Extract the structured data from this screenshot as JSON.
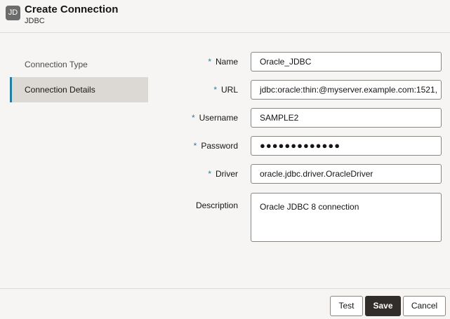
{
  "header": {
    "badge": "JD",
    "title": "Create Connection",
    "subtitle": "JDBC"
  },
  "nav": {
    "items": [
      {
        "label": "Connection Type",
        "active": false
      },
      {
        "label": "Connection Details",
        "active": true
      }
    ]
  },
  "form": {
    "required_marker": "*",
    "name": {
      "label": "Name",
      "value": "Oracle_JDBC"
    },
    "url": {
      "label": "URL",
      "value": "jdbc:oracle:thin:@myserver.example.com:1521,"
    },
    "username": {
      "label": "Username",
      "value": "SAMPLE2"
    },
    "password": {
      "label": "Password",
      "value": "●●●●●●●●●●●●●"
    },
    "driver": {
      "label": "Driver",
      "value": "oracle.jdbc.driver.OracleDriver"
    },
    "description": {
      "label": "Description",
      "value": "Oracle JDBC 8 connection"
    }
  },
  "footer": {
    "test_label": "Test",
    "save_label": "Save",
    "cancel_label": "Cancel"
  },
  "colors": {
    "accent": "#227e9e",
    "primary_button": "#312d2a",
    "background": "#f6f5f3"
  }
}
